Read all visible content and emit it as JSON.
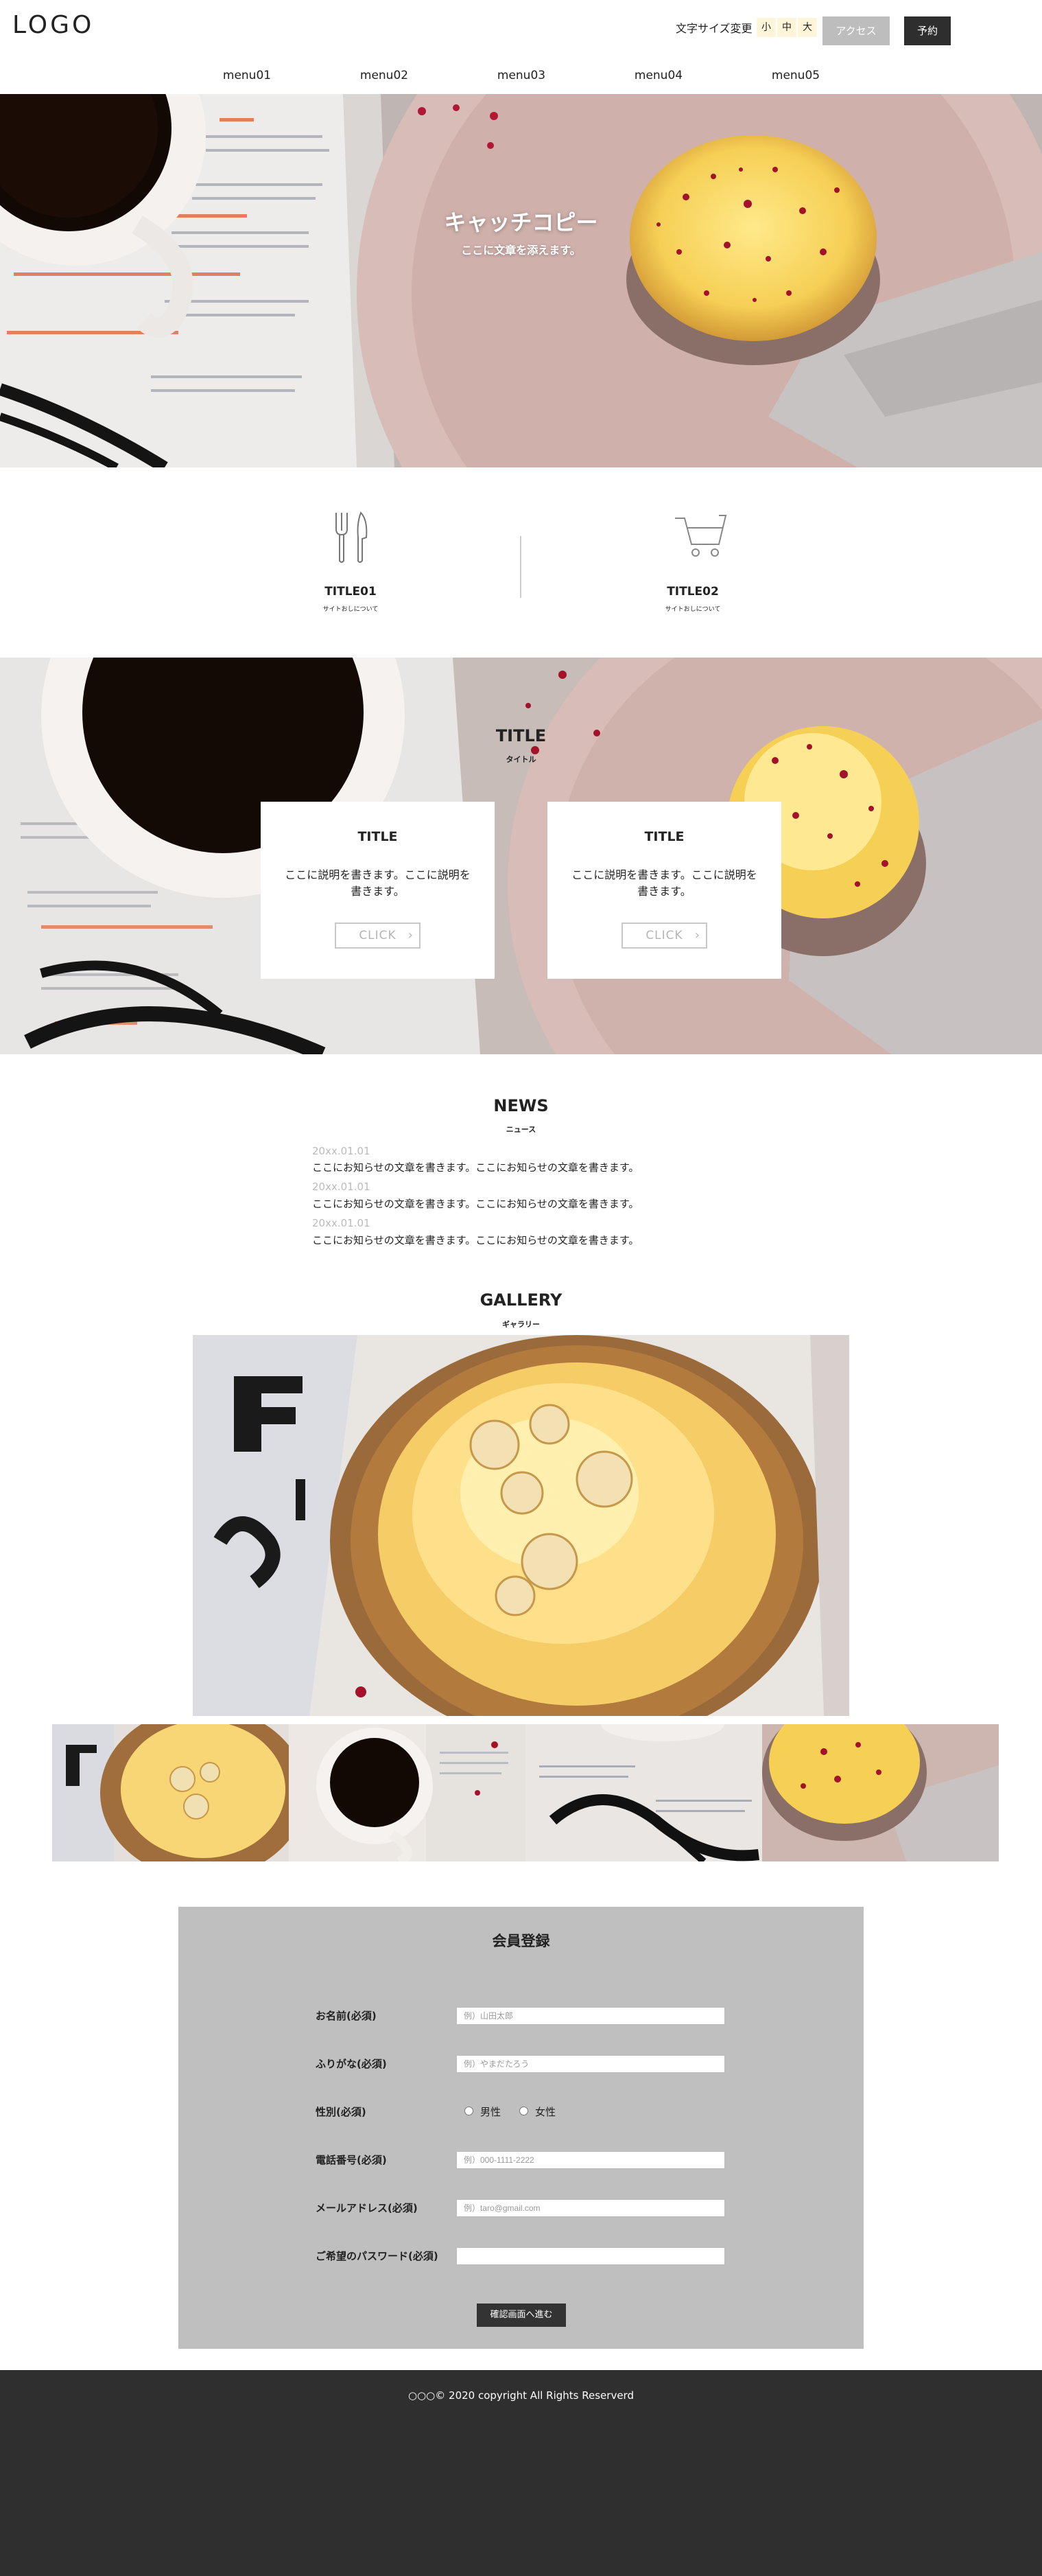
{
  "header": {
    "logo": "LOGO",
    "font_size_label": "文字サイズ変更",
    "font_sizes": [
      "小",
      "中",
      "大"
    ],
    "access_label": "アクセス",
    "reserve_label": "予約"
  },
  "nav": [
    "menu01",
    "menu02",
    "menu03",
    "menu04",
    "menu05"
  ],
  "hero": {
    "catch_copy": "キャッチコピー",
    "sub_copy": "ここに文章を添えます。"
  },
  "features": [
    {
      "title": "TITLE01",
      "sub": "サイトおしについて",
      "icon": "fork-knife-icon"
    },
    {
      "title": "TITLE02",
      "sub": "サイトおしについて",
      "icon": "shopping-cart-icon"
    }
  ],
  "title_section": {
    "title": "TITLE",
    "sub": "タイトル",
    "cards": [
      {
        "title": "TITLE",
        "text": "ここに説明を書きます。ここに説明を書きます。",
        "button": "CLICK"
      },
      {
        "title": "TITLE",
        "text": "ここに説明を書きます。ここに説明を書きます。",
        "button": "CLICK"
      }
    ]
  },
  "news": {
    "title": "NEWS",
    "sub": "ニュース",
    "items": [
      {
        "date": "20xx.01.01",
        "text": "ここにお知らせの文章を書きます。ここにお知らせの文章を書きます。"
      },
      {
        "date": "20xx.01.01",
        "text": "ここにお知らせの文章を書きます。ここにお知らせの文章を書きます。"
      },
      {
        "date": "20xx.01.01",
        "text": "ここにお知らせの文章を書きます。ここにお知らせの文章を書きます。"
      }
    ]
  },
  "gallery": {
    "title": "GALLERY",
    "sub": "ギャラリー"
  },
  "form": {
    "title": "会員登録",
    "name_label": "お名前(必須)",
    "name_placeholder": "例）山田太郎",
    "furigana_label": "ふりがな(必須)",
    "furigana_placeholder": "例）やまだたろう",
    "gender_label": "性別(必須)",
    "gender_male": "男性",
    "gender_female": "女性",
    "phone_label": "電話番号(必須)",
    "phone_placeholder": "例）000-1111-2222",
    "email_label": "メールアドレス(必須)",
    "email_placeholder": "例）taro@gmail.com",
    "password_label": "ご希望のパスワード(必須)",
    "password_value": "",
    "submit_label": "確認画面へ進む"
  },
  "footer": {
    "copyright": "○○○© 2020 copyright All Rights Reserverd"
  },
  "colors": {
    "dark": "#2e2e2e",
    "gray_button": "#bdbdbd",
    "form_bg": "#bfbfbf",
    "footer_bg": "#2f2f2f",
    "font_size_bg": "#fff6d9"
  }
}
